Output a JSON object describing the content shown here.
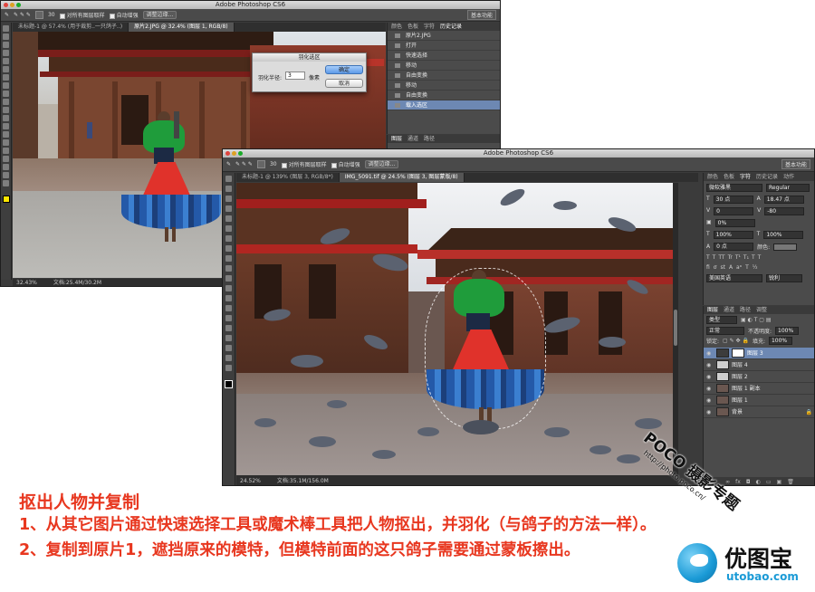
{
  "back_window": {
    "app_title": "Adobe Photoshop CS6",
    "options": {
      "check1_label": "对所有图层取样",
      "check2_label": "自动增强",
      "refine_label": "调整边缘...",
      "workspace": "基本功能",
      "brush_size": "30"
    },
    "tabs": [
      "未标题-1 @ 57.4% (用于裁剪..一只鸽子..)",
      "原片2.JPG @ 32.4% (图层 1, RGB/8)"
    ],
    "history_tabs": [
      "颜色",
      "色板",
      "字符",
      "历史记录"
    ],
    "history_file": "原片2.JPG",
    "history_items": [
      "打开",
      "快速选择",
      "移动",
      "自由变换",
      "移动",
      "自由变换",
      "载入选区"
    ],
    "status_zoom": "32.43%",
    "status_doc": "文档:25.4M/30.2M",
    "layers_tabs": [
      "图层",
      "通道",
      "路径"
    ]
  },
  "feather_dialog": {
    "title": "羽化选区",
    "radius_label": "羽化半径:",
    "radius_value": "3",
    "unit": "像素",
    "ok_label": "确定",
    "cancel_label": "取消"
  },
  "front_window": {
    "app_title": "Adobe Photoshop CS6",
    "options": {
      "check1_label": "对所有图层取样",
      "check2_label": "自动增强",
      "refine_label": "调整边缘...",
      "workspace": "基本功能",
      "brush_size": "30"
    },
    "tabs": [
      "未标题-1 @ 139% (图层 3, RGB/8*)",
      "IMG_5091.tif @ 24.5% (图层 3, 图层蒙版/8)"
    ],
    "status_zoom": "24.52%",
    "status_doc": "文档:35.1M/156.0M",
    "char_tabs": [
      "颜色",
      "色板",
      "字符",
      "历史记录",
      "动作"
    ],
    "char": {
      "font": "微软雅黑",
      "style": "Regular",
      "size": "30 点",
      "leading": "18.47 点",
      "kerning": "0",
      "tracking": "-80",
      "scale_pct": "0%",
      "vscale": "100%",
      "hscale": "100%",
      "baseline": "0 点",
      "color_label": "颜色:",
      "lang": "美国英语",
      "aa": "锐利"
    },
    "layers_tabs": [
      "图层",
      "通道",
      "路径",
      "调整"
    ],
    "layers_filter": "类型",
    "blend_mode": "正常",
    "opacity_label": "不透明度:",
    "opacity": "100%",
    "lock_label": "锁定:",
    "fill_label": "填充:",
    "fill": "100%",
    "layers": [
      {
        "name": "图层 3",
        "selected": true
      },
      {
        "name": "图层 4",
        "selected": false
      },
      {
        "name": "图层 2",
        "selected": false
      },
      {
        "name": "图层 1 副本",
        "selected": false
      },
      {
        "name": "图层 1",
        "selected": false
      },
      {
        "name": "背景",
        "selected": false
      }
    ]
  },
  "caption": {
    "heading": "抠出人物并复制",
    "line1": "1、从其它图片通过快速选择工具或魔术棒工具把人物抠出，并羽化（与鸽子的方法一样）。",
    "line2": "2、复制到原片1，遮挡原来的模特，但模特前面的这只鸽子需要通过蒙板擦出。"
  },
  "watermark": {
    "poco": "POCO 摄影专题",
    "url": "http://photo.poco.cn/",
    "brand_cn": "优图宝",
    "brand_url": "utobao.com"
  },
  "colors": {
    "accent_red": "#e8371f",
    "selection_blue": "#6d88b3",
    "brand_blue": "#1a9ad6"
  }
}
